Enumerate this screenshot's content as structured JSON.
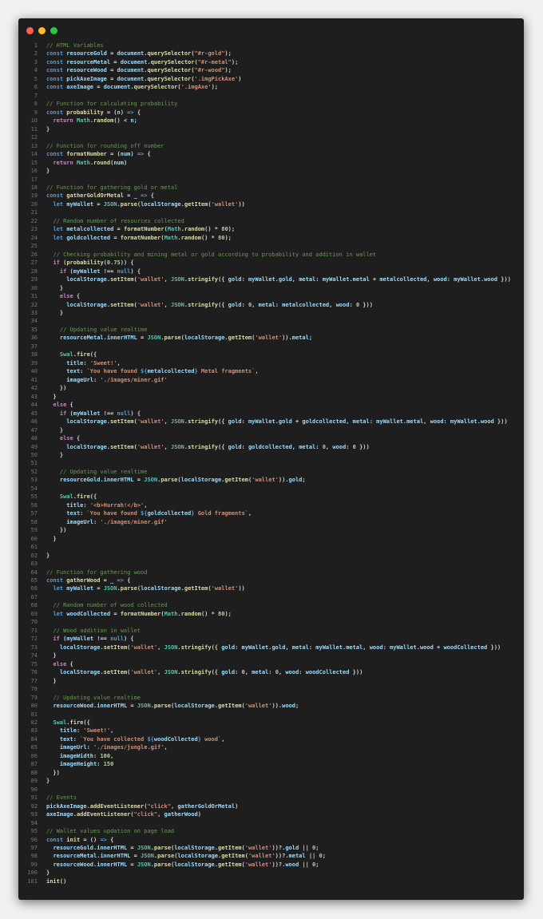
{
  "window": {
    "controls": {
      "close_color": "#ff5f57",
      "minimize_color": "#febc2e",
      "maximize_color": "#28c840"
    }
  },
  "colors": {
    "keyword": "#569cd6",
    "control": "#c586c0",
    "string": "#ce9178",
    "comment": "#6a9955",
    "variable": "#9cdcfe",
    "function": "#dcdcaa",
    "number": "#b5cea8",
    "class": "#4ec9b0",
    "constant": "#4fc1ff",
    "text": "#d4d4d4",
    "line_number": "#6e7681",
    "background": "#1e1e1e"
  },
  "code": {
    "lines": [
      "// HTML Variables",
      "const resourceGold = document.querySelector(\"#r-gold\");",
      "const resourceMetal = document.querySelector(\"#r-metal\");",
      "const resourceWood = document.querySelector(\"#r-wood\");",
      "const pickAxeImage = document.querySelector('.imgPickAxe')",
      "const axeImage = document.querySelector('.imgAxe');",
      "",
      "// Function for calculating probability",
      "const probability = (n) => {",
      "  return Math.random() < n;",
      "}",
      "",
      "// Function for rounding off number",
      "const formatNumber = (num) => {",
      "  return Math.round(num)",
      "}",
      "",
      "// Function for gathering gold or metal",
      "const gatherGoldOrMetal = _ => {",
      "  let myWallet = JSON.parse(localStorage.getItem('wallet'))",
      "",
      "  // Random number of resources collected",
      "  let metalcollected = formatNumber(Math.random() * 80);",
      "  let goldcollected = formatNumber(Math.random() * 80);",
      "",
      "  // Checking probability and mining metal or gold according to probability and addition in wallet",
      "  if (probability(0.75)) {",
      "    if (myWallet !== null) {",
      "      localStorage.setItem('wallet', JSON.stringify({ gold: myWallet.gold, metal: myWallet.metal + metalcollected, wood: myWallet.wood }))",
      "    }",
      "    else {",
      "      localStorage.setItem('wallet', JSON.stringify({ gold: 0, metal: metalcollected, wood: 0 }))",
      "    }",
      "",
      "    // Updating value realtime",
      "    resourceMetal.innerHTML = JSON.parse(localStorage.getItem('wallet')).metal;",
      "",
      "    Swal.fire({",
      "      title: 'Sweet!',",
      "      text: `You have found ${metalcollected} Metal fragments`,",
      "      imageUrl: './images/miner.gif'",
      "    })",
      "  }",
      "  else {",
      "    if (myWallet !== null) {",
      "      localStorage.setItem('wallet', JSON.stringify({ gold: myWallet.gold + goldcollected, metal: myWallet.metal, wood: myWallet.wood }))",
      "    }",
      "    else {",
      "      localStorage.setItem('wallet', JSON.stringify({ gold: goldcollected, metal: 0, wood: 0 }))",
      "    }",
      "",
      "    // Updating value realtime",
      "    resourceGold.innerHTML = JSON.parse(localStorage.getItem('wallet')).gold;",
      "",
      "    Swal.fire({",
      "      title: '<b>Hurrah!</b>',",
      "      text: `You have found ${goldcollected} Gold fragments`,",
      "      imageUrl: './images/miner.gif'",
      "    })",
      "  }",
      "",
      "}",
      "",
      "// Function for gathering wood",
      "const gatherWood = _ => {",
      "  let myWallet = JSON.parse(localStorage.getItem('wallet'))",
      "",
      "  // Random number of wood collected",
      "  let woodCollected = formatNumber(Math.random() * 80);",
      "",
      "  // Wood addition in wallet",
      "  if (myWallet !== null) {",
      "    localStorage.setItem('wallet', JSON.stringify({ gold: myWallet.gold, metal: myWallet.metal, wood: myWallet.wood + woodCollected }))",
      "  }",
      "  else {",
      "    localStorage.setItem('wallet', JSON.stringify({ gold: 0, metal: 0, wood: woodCollected }))",
      "  }",
      "",
      "  // Updating value realtime",
      "  resourceWood.innerHTML = JSON.parse(localStorage.getItem('wallet')).wood;",
      "",
      "  Swal.fire({",
      "    title: 'Sweet!',",
      "    text: `You have collected ${woodCollected} wood`,",
      "    imageUrl: './images/jungle.gif',",
      "    imageWidth: 100,",
      "    imageHeight: 150",
      "  })",
      "}",
      "",
      "// Events",
      "pickAxeImage.addEventListener(\"click\", gatherGoldOrMetal)",
      "axeImage.addEventListener(\"click\", gatherWood)",
      "",
      "// Wallet values updation on page load",
      "const init = () => {",
      "  resourceGold.innerHTML = JSON.parse(localStorage.getItem('wallet'))?.gold || 0;",
      "  resourceMetal.innerHTML = JSON.parse(localStorage.getItem('wallet'))?.metal || 0;",
      "  resourceWood.innerHTML = JSON.parse(localStorage.getItem('wallet'))?.wood || 0;",
      "}",
      "init()"
    ]
  }
}
